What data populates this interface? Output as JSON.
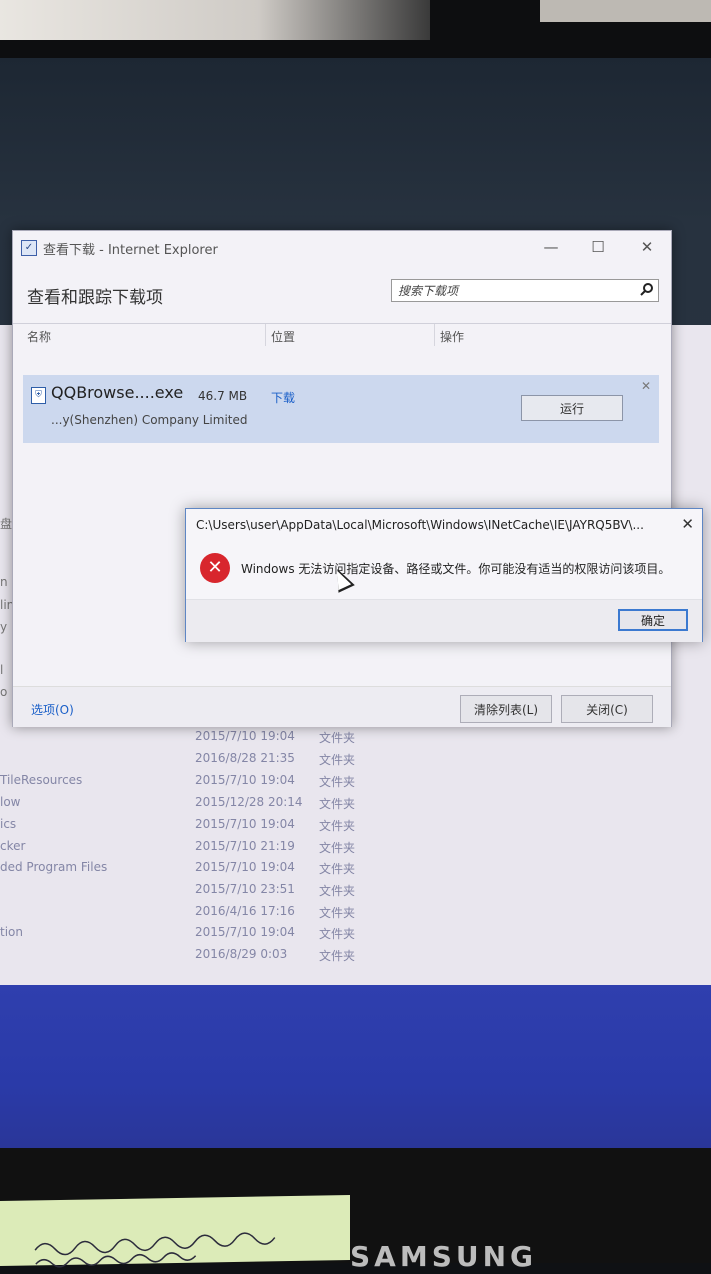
{
  "ie_window": {
    "title": "查看下载 - Internet Explorer",
    "heading": "查看和跟踪下载项",
    "search_placeholder": "搜索下载项",
    "columns": [
      "名称",
      "位置",
      "操作"
    ],
    "download": {
      "filename": "QQBrowse....exe",
      "size": "46.7 MB",
      "location": "下载",
      "publisher": "...y(Shenzhen) Company Limited",
      "run_label": "运行"
    },
    "options_label": "选项(O)",
    "clear_list_label": "清除列表(L)",
    "close_label": "关闭(C)"
  },
  "error_dialog": {
    "title": "C:\\Users\\user\\AppData\\Local\\Microsoft\\Windows\\INetCache\\IE\\JAYRQ5BV\\...",
    "message": "Windows 无法访问指定设备、路径或文件。你可能没有适当的权限访问该项目。",
    "ok_label": "确定"
  },
  "explorer_rows": [
    {
      "name": "",
      "date": "2015/7/10 19:04",
      "type": "文件夹"
    },
    {
      "name": "",
      "date": "2016/8/28 21:35",
      "type": "文件夹"
    },
    {
      "name": "TileResources",
      "date": "2015/7/10 19:04",
      "type": "文件夹"
    },
    {
      "name": "low",
      "date": "2015/12/28 20:14",
      "type": "文件夹"
    },
    {
      "name": "ics",
      "date": "2015/7/10 19:04",
      "type": "文件夹"
    },
    {
      "name": "cker",
      "date": "2015/7/10 21:19",
      "type": "文件夹"
    },
    {
      "name": "ded Program Files",
      "date": "2015/7/10 19:04",
      "type": "文件夹"
    },
    {
      "name": "",
      "date": "2015/7/10 23:51",
      "type": "文件夹"
    },
    {
      "name": "",
      "date": "2016/4/16 17:16",
      "type": "文件夹"
    },
    {
      "name": "tion",
      "date": "2015/7/10 19:04",
      "type": "文件夹"
    },
    {
      "name": "",
      "date": "2016/8/29 0:03",
      "type": "文件夹"
    }
  ],
  "explorer_left_labels": [
    "盘",
    "n",
    "lin",
    "y",
    "l",
    "o"
  ],
  "monitor_brand": "SAMSUNG",
  "colors": {
    "accent": "#3b79d0",
    "error": "#d8262d",
    "desktop": "#2f3fae"
  }
}
